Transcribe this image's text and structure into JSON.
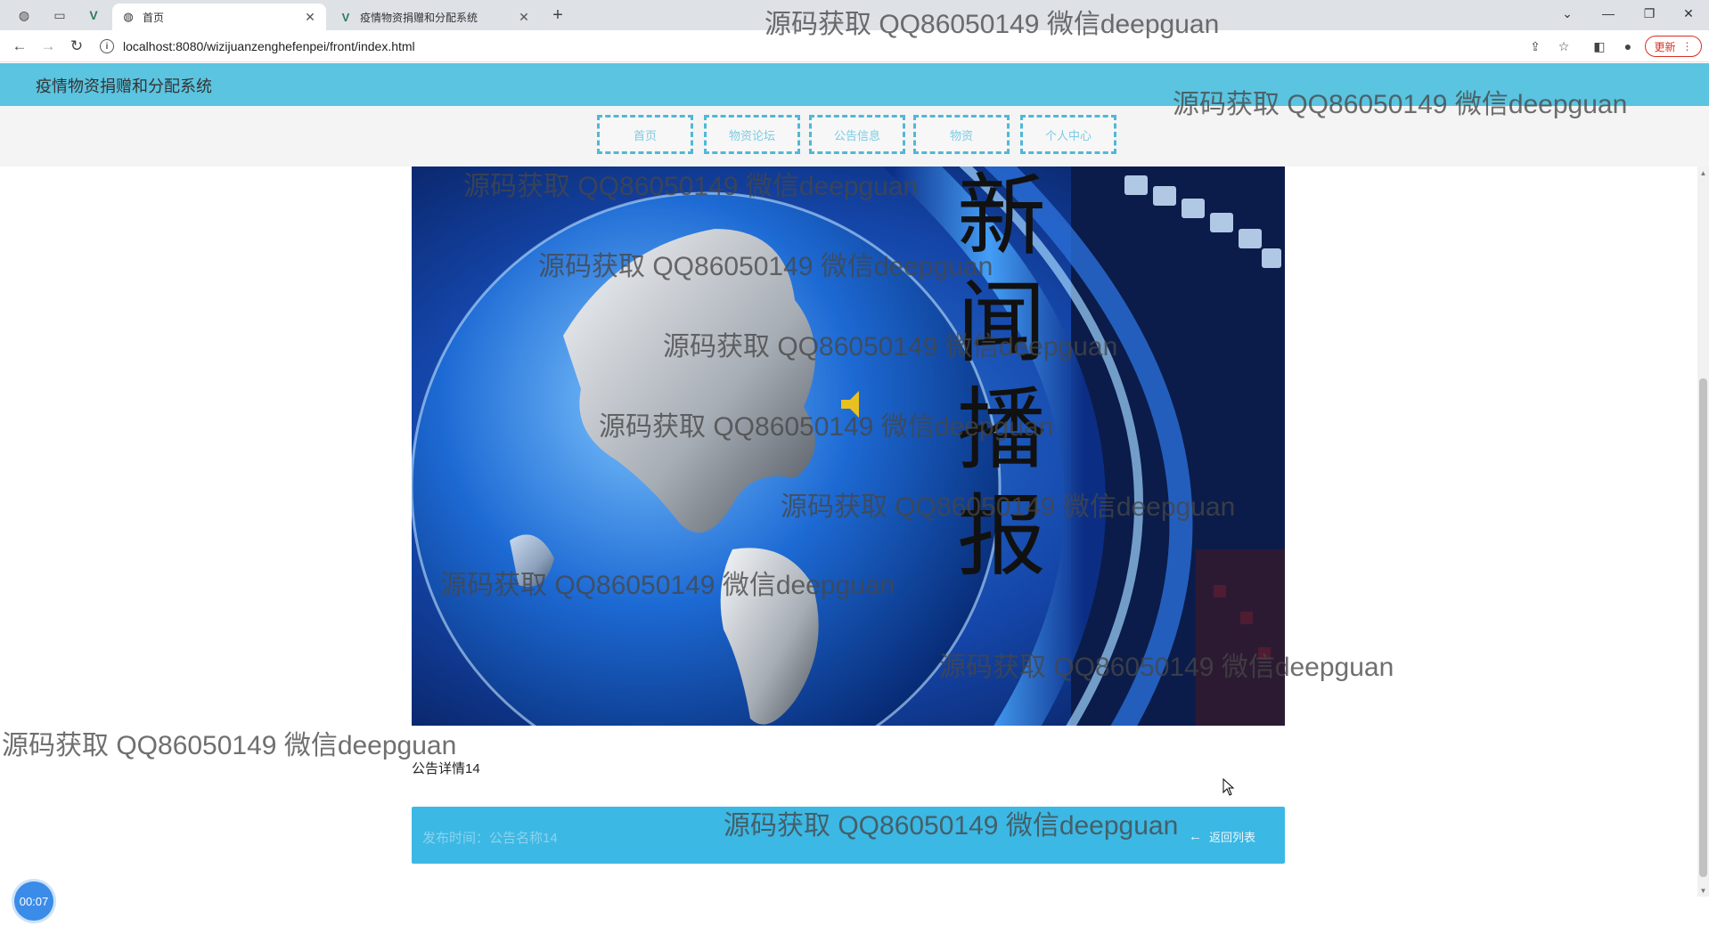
{
  "browser": {
    "tabs": [
      {
        "title": "首页",
        "active": true
      },
      {
        "title": "疫情物资捐赠和分配系统",
        "active": false
      }
    ],
    "url": "localhost:8080/wizijuanzenghefenpei/front/index.html",
    "update_label": "更新"
  },
  "app": {
    "title": "疫情物资捐赠和分配系统"
  },
  "nav": {
    "items": [
      "首页",
      "物资论坛",
      "公告信息",
      "物资",
      "个人中心"
    ]
  },
  "banner": {
    "caption": "新闻播报"
  },
  "detail": {
    "title": "公告详情14",
    "info_text": "发布时间：公告名称14",
    "back_label": "返回列表"
  },
  "timer": "00:07",
  "watermark": "源码获取 QQ86050149 微信deepguan",
  "colors": {
    "header": "#5bc4e0",
    "nav_border": "#4fb8d8",
    "info_bar": "#3cb8e4",
    "timer": "#3b8ce8"
  }
}
